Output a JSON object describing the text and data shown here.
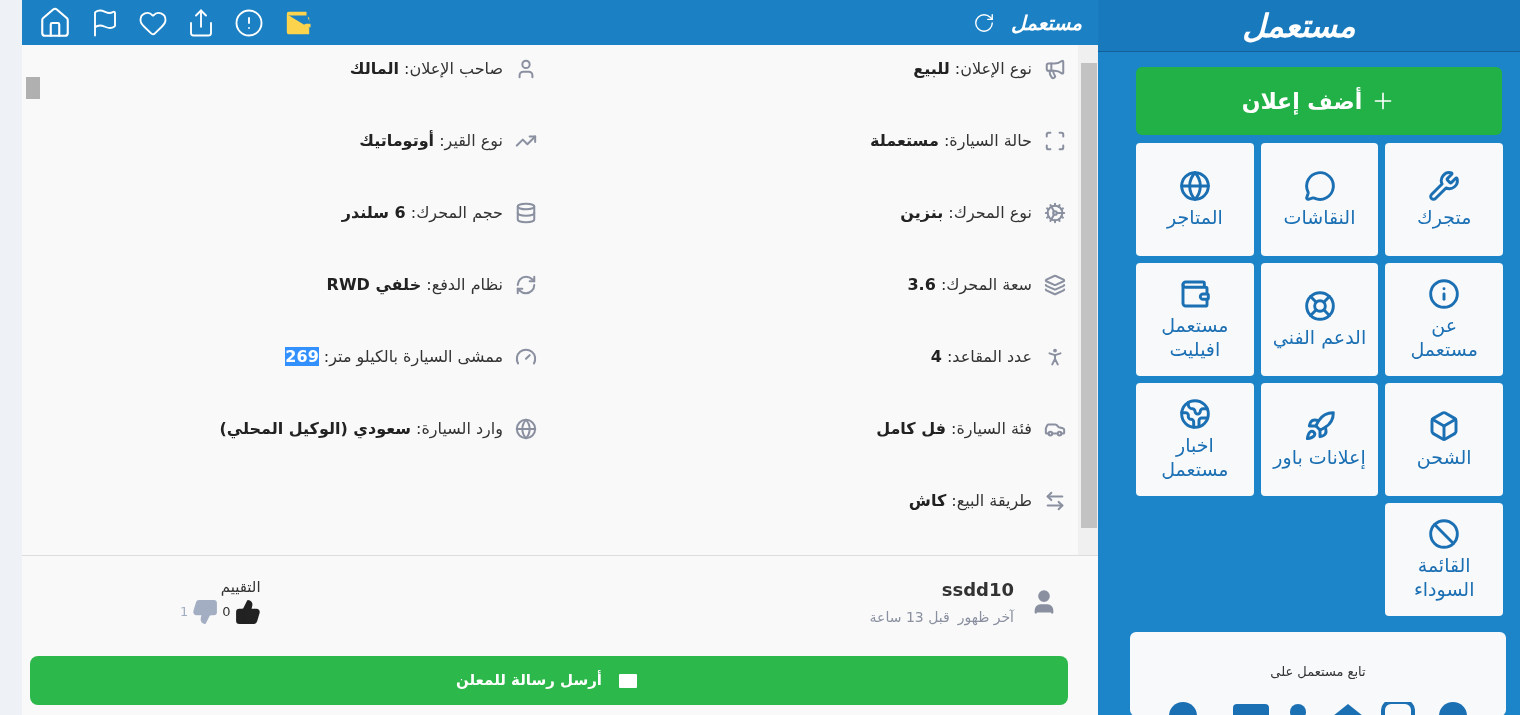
{
  "header": {
    "logo": "مستعمل"
  },
  "specs": [
    {
      "kind": "megaphone",
      "label": "نوع الإعلان:",
      "value": "للبيع",
      "highlighted": false
    },
    {
      "kind": "user",
      "label": "صاحب الإعلان:",
      "value": "المالك",
      "highlighted": false
    },
    {
      "kind": "scan",
      "label": "حالة السيارة:",
      "value": "مستعملة",
      "highlighted": false
    },
    {
      "kind": "trend",
      "label": "نوع القير:",
      "value": "أوتوماتيك",
      "highlighted": false
    },
    {
      "kind": "cog",
      "label": "نوع المحرك:",
      "value": "بنزين",
      "highlighted": false
    },
    {
      "kind": "database",
      "label": "حجم المحرك:",
      "value": "6 سلندر",
      "highlighted": false
    },
    {
      "kind": "layers",
      "label": "سعة المحرك:",
      "value": "3.6",
      "highlighted": false
    },
    {
      "kind": "refresh",
      "label": "نظام الدفع:",
      "value": "خلفي RWD",
      "highlighted": false
    },
    {
      "kind": "person",
      "label": "عدد المقاعد:",
      "value": "4",
      "highlighted": false
    },
    {
      "kind": "gauge",
      "label": "ممشى السيارة بالكيلو متر:",
      "value": "269",
      "highlighted": true
    },
    {
      "kind": "car",
      "label": "فئة السيارة:",
      "value": "فل كامل",
      "highlighted": false
    },
    {
      "kind": "globe",
      "label": "وارد السيارة:",
      "value": "سعودي (الوكيل المحلي)",
      "highlighted": false
    },
    {
      "kind": "swap",
      "label": "طريقة البيع:",
      "value": "كاش",
      "highlighted": false
    }
  ],
  "seller": {
    "name": "ssdd10",
    "last_seen_label": "آخر ظهور",
    "last_seen": "قبل 13 ساعة",
    "rating_label": "التقييم",
    "likes": "0",
    "dislikes": "1"
  },
  "message_button": "أرسل رسالة للمعلن",
  "sidebar": {
    "logo": "مستعمل",
    "add_button": "أضف إعلان",
    "tiles": [
      {
        "kind": "tools",
        "label": "متجرك"
      },
      {
        "kind": "chat",
        "label": "النقاشات"
      },
      {
        "kind": "globe",
        "label": "المتاجر"
      },
      {
        "kind": "info",
        "label": "عن مستعمل"
      },
      {
        "kind": "lifebuoy",
        "label": "الدعم الفني"
      },
      {
        "kind": "wallet",
        "label": "مستعمل افيليت"
      },
      {
        "kind": "box",
        "label": "الشحن"
      },
      {
        "kind": "rocket",
        "label": "إعلانات باور"
      },
      {
        "kind": "earth",
        "label": "اخبار مستعمل"
      },
      {
        "kind": "ban",
        "label": "القائمة السوداء"
      }
    ],
    "follow_title": "تابع مستعمل على"
  }
}
